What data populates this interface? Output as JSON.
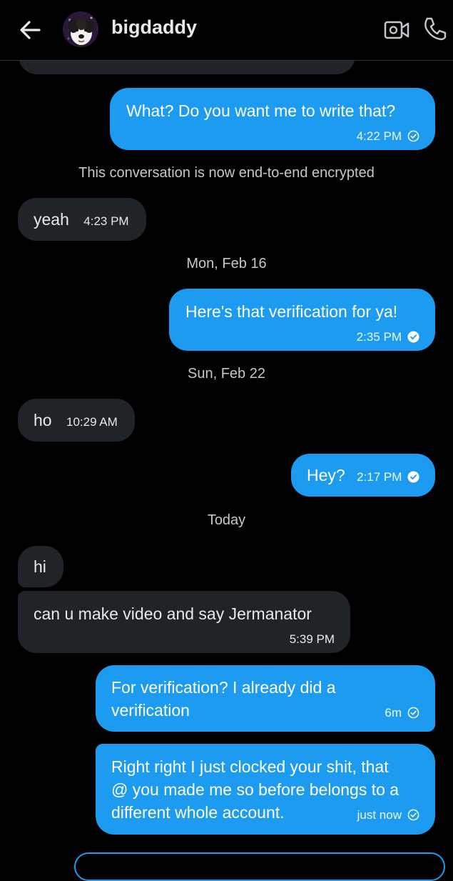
{
  "header": {
    "title": "bigdaddy"
  },
  "messages": [
    {
      "direction": "out",
      "text": "What? Do you want me to write that?",
      "time": "4:22 PM"
    },
    {
      "direction": "system",
      "text": "This conversation is now end-to-end encrypted"
    },
    {
      "direction": "in",
      "text": "yeah",
      "time": "4:23 PM"
    },
    {
      "direction": "date",
      "text": "Mon, Feb 16"
    },
    {
      "direction": "out",
      "text": "Here's that verification for ya!",
      "time": "2:35 PM"
    },
    {
      "direction": "date",
      "text": "Sun, Feb 22"
    },
    {
      "direction": "in",
      "text": "ho",
      "time": "10:29 AM"
    },
    {
      "direction": "out",
      "text": "Hey?",
      "time": "2:17 PM"
    },
    {
      "direction": "date",
      "text": "Today"
    },
    {
      "direction": "in",
      "text": "hi"
    },
    {
      "direction": "in",
      "text": "can u make video and say Jermanator",
      "time": "5:39 PM"
    },
    {
      "direction": "out",
      "lines": [
        "For verification? I already did a",
        "verification"
      ],
      "time": "6m"
    },
    {
      "direction": "out",
      "lines": [
        "Right right I just clocked your shit, that",
        "@ you made me so before belongs to a",
        "different whole account."
      ],
      "time": "just now"
    }
  ],
  "colors": {
    "background": "#000000",
    "outgoing_bubble": "#1d9bf0",
    "incoming_bubble": "#202327",
    "text": "#e7e9ea"
  },
  "icons": {
    "back": "arrow-left-icon",
    "video": "video-camera-icon",
    "call": "phone-icon",
    "check": "check-circle-icon"
  }
}
